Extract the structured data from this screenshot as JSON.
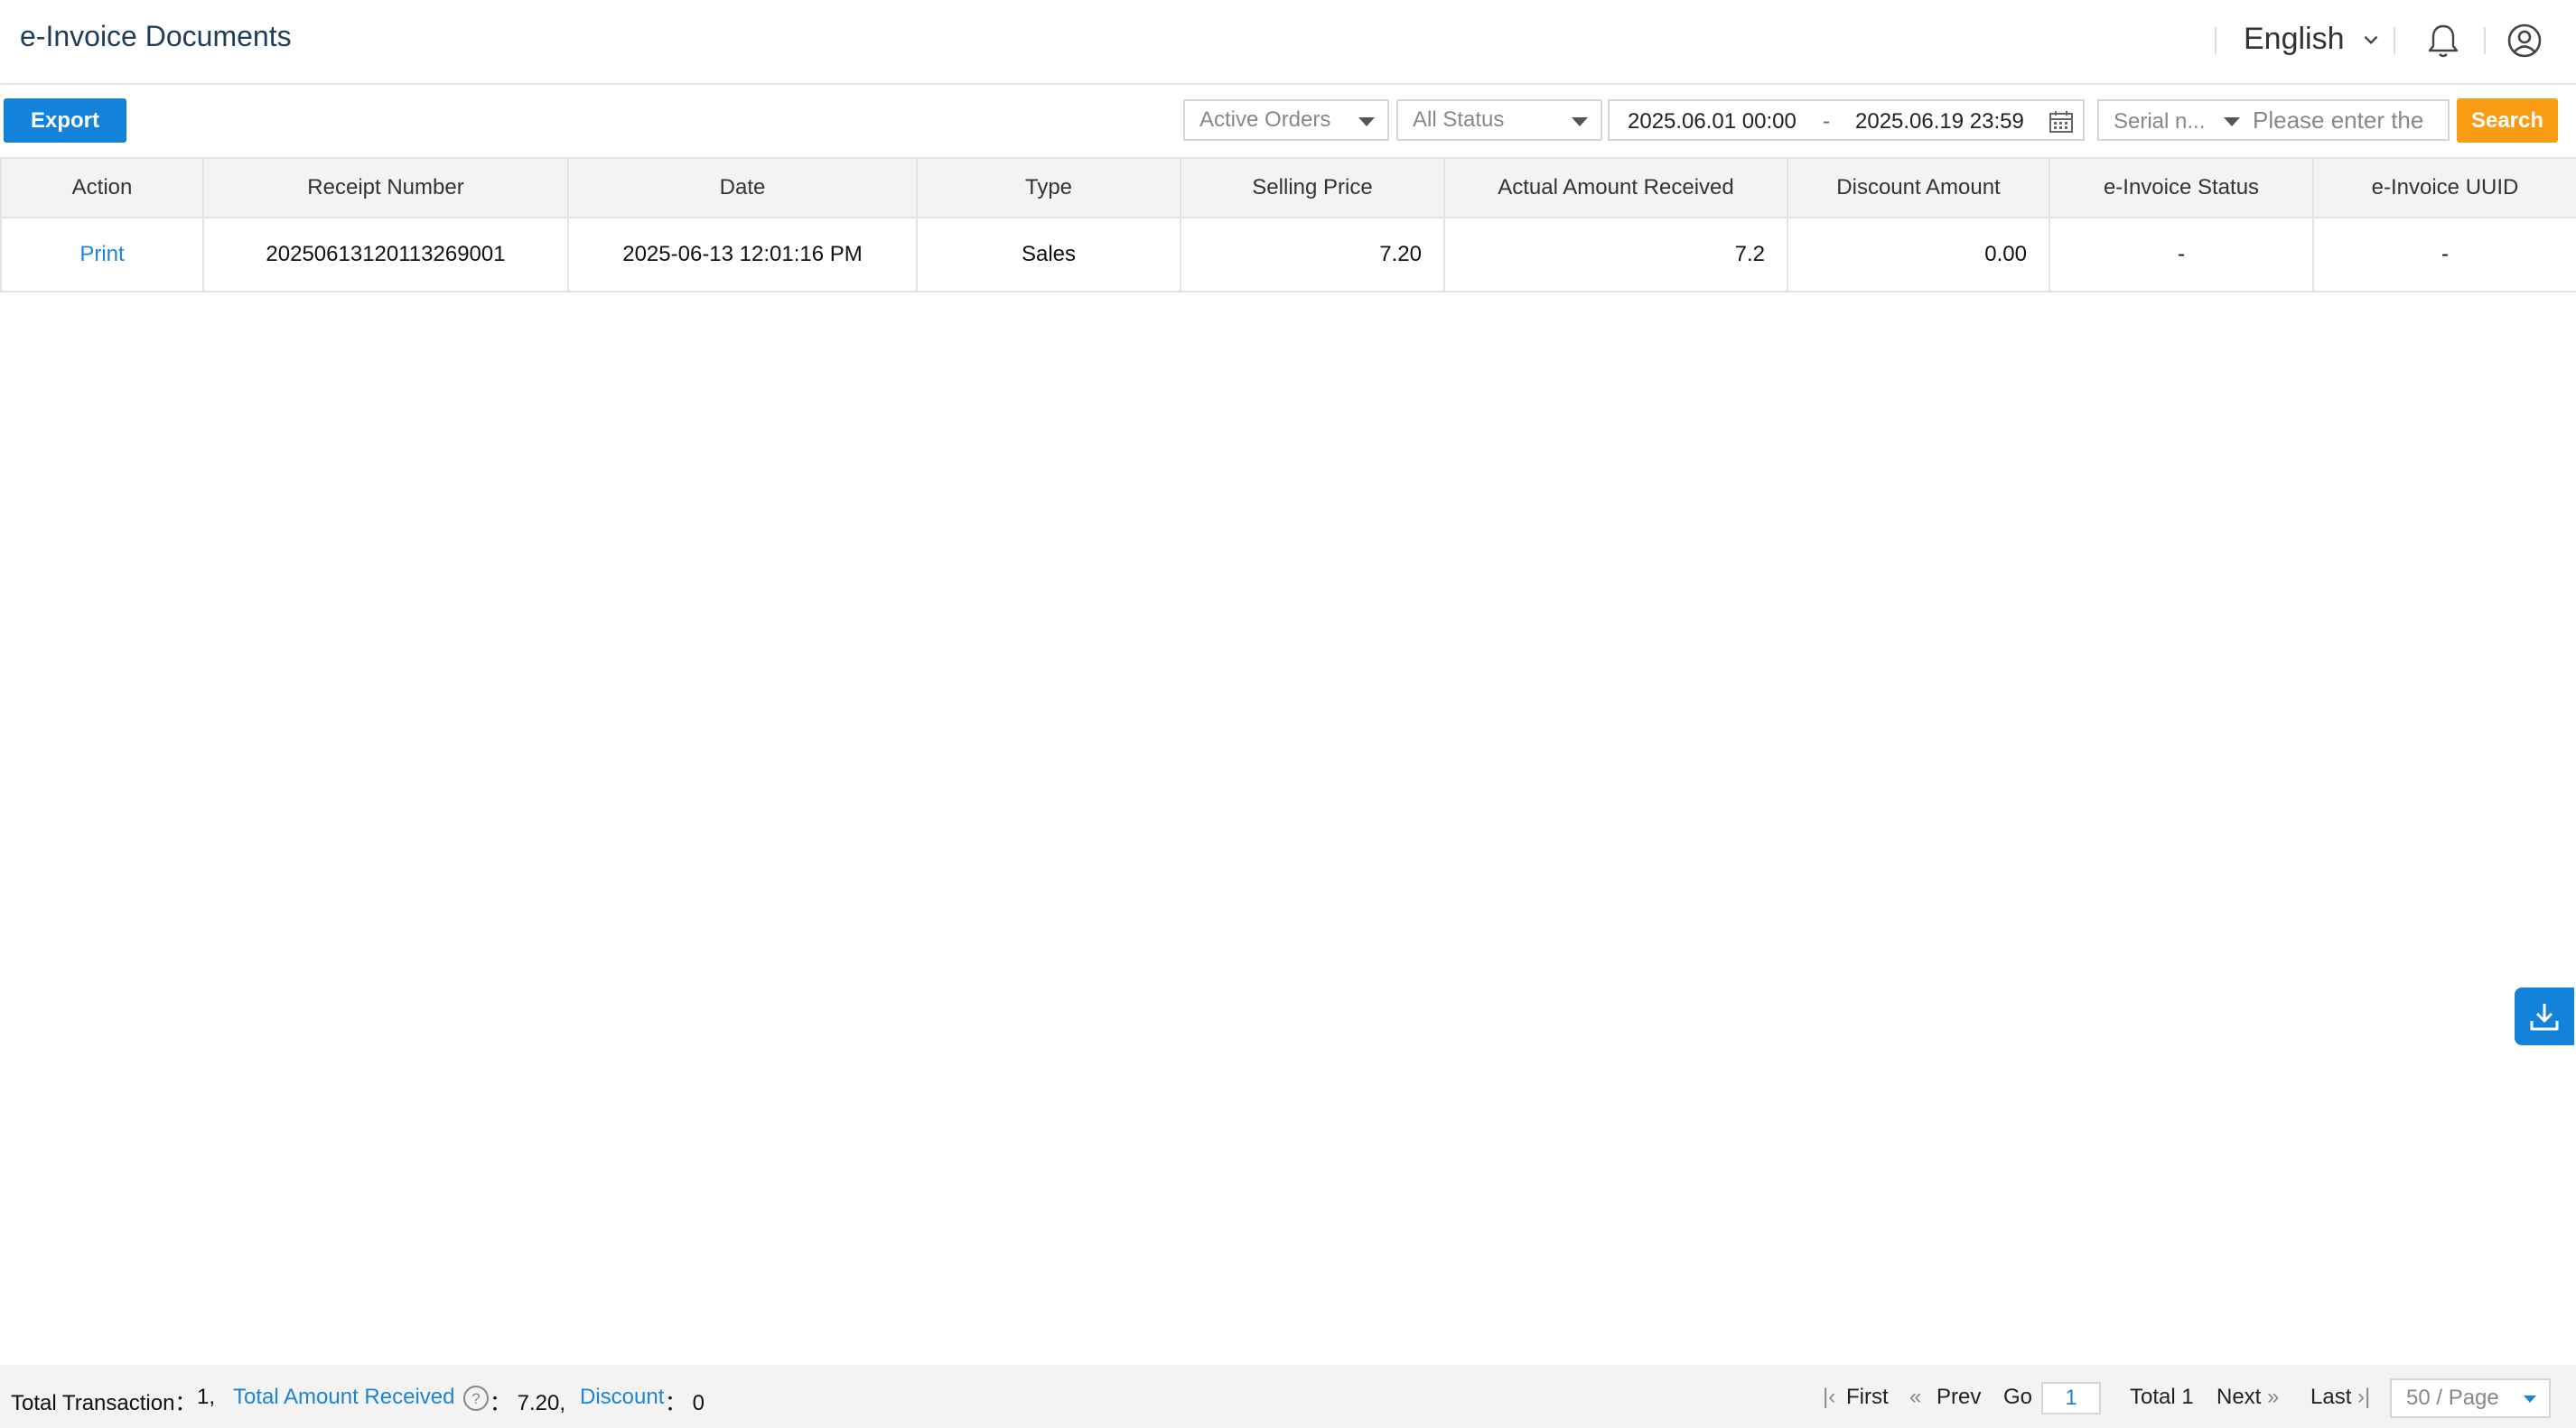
{
  "header": {
    "title": "e-Invoice Documents",
    "language": "English",
    "icons": [
      "chevron-down-icon",
      "bell-icon",
      "user-icon"
    ]
  },
  "toolbar": {
    "export_label": "Export",
    "order_filter": "Active Orders",
    "status_filter": "All Status",
    "date_start": "2025.06.01 00:00",
    "date_separator": "-",
    "date_end": "2025.06.19 23:59",
    "search_field_type": "Serial n...",
    "search_placeholder": "Please enter the",
    "search_label": "Search"
  },
  "table": {
    "columns": [
      "Action",
      "Receipt Number",
      "Date",
      "Type",
      "Selling Price",
      "Actual Amount Received",
      "Discount Amount",
      "e-Invoice Status",
      "e-Invoice UUID"
    ],
    "rows": [
      {
        "action": "Print",
        "receipt_number": "20250613120113269001",
        "date": "2025-06-13 12:01:16 PM",
        "type": "Sales",
        "selling_price": "7.20",
        "actual_amount_received": "7.2",
        "discount_amount": "0.00",
        "einvoice_status": "-",
        "einvoice_uuid": "-"
      }
    ]
  },
  "footer": {
    "total_transaction_label": "Total Transaction：",
    "total_transaction_value": "1,",
    "total_amount_label": "Total Amount Received",
    "total_amount_value": "： 7.20,",
    "discount_label": "Discount",
    "discount_value": "： 0",
    "pagination": {
      "first": "First",
      "prev": "Prev",
      "go": "Go",
      "current_page": "1",
      "total": "Total 1",
      "next": "Next",
      "last": "Last",
      "page_size": "50 / Page"
    }
  },
  "colors": {
    "primary_blue": "#1282db",
    "search_orange": "#f99b13",
    "link_blue": "#1e84d6"
  }
}
